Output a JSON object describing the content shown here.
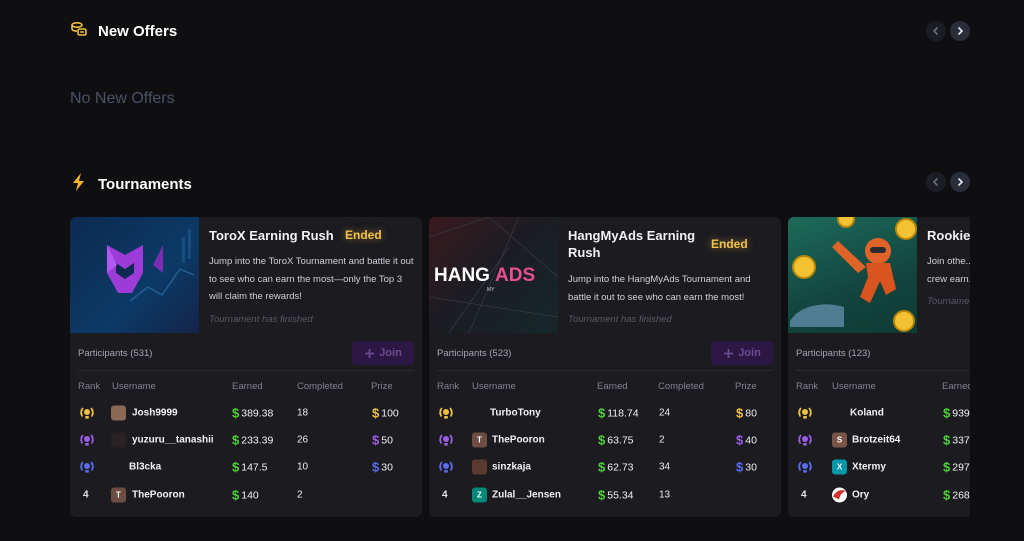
{
  "offers": {
    "title": "New Offers",
    "icon": "coins-icon",
    "empty_text": "No New Offers"
  },
  "tournaments": {
    "title": "Tournaments",
    "icon": "lightning-icon",
    "headers": {
      "rank": "Rank",
      "username": "Username",
      "earned": "Earned",
      "completed": "Completed",
      "prize": "Prize"
    },
    "join_label": "Join",
    "cards": [
      {
        "title": "ToroX Earning Rush",
        "status": "Ended",
        "description": "Jump into the ToroX Tournament and battle it out to see who can earn the most—only the Top 3 will claim the rewards!",
        "finished": "Tournament has finished",
        "participants": "Participants (531)",
        "rows": [
          {
            "rank": "1",
            "username": "Josh9999",
            "earned": "389.38",
            "completed": "18",
            "prize": "100",
            "avatar_letter": "",
            "avatar_color": "#8a6a55"
          },
          {
            "rank": "2",
            "username": "yuzuru__tanashii",
            "earned": "233.39",
            "completed": "26",
            "prize": "50",
            "avatar_letter": "",
            "avatar_color": "#2b2024"
          },
          {
            "rank": "3",
            "username": "Bl3cka",
            "earned": "147.5",
            "completed": "10",
            "prize": "30",
            "avatar_letter": "",
            "avatar_color": ""
          },
          {
            "rank": "4",
            "username": "ThePooron",
            "earned": "140",
            "completed": "2",
            "prize": "",
            "avatar_letter": "T",
            "avatar_color": "#6d4c41"
          }
        ]
      },
      {
        "title": "HangMyAds Earning Rush",
        "status": "Ended",
        "description": "Jump into the HangMyAds Tournament and battle it out to see who can earn the most!",
        "finished": "Tournament has finished",
        "participants": "Participants (523)",
        "thumb_text": {
          "a": "HANG",
          "my": "MY",
          "b": "ADS"
        },
        "rows": [
          {
            "rank": "1",
            "username": "TurboTony",
            "earned": "118.74",
            "completed": "24",
            "prize": "80",
            "avatar_letter": "",
            "avatar_color": ""
          },
          {
            "rank": "2",
            "username": "ThePooron",
            "earned": "63.75",
            "completed": "2",
            "prize": "40",
            "avatar_letter": "T",
            "avatar_color": "#6d4c41"
          },
          {
            "rank": "3",
            "username": "sinzkaja",
            "earned": "62.73",
            "completed": "34",
            "prize": "30",
            "avatar_letter": "",
            "avatar_color": "#5a3a2e"
          },
          {
            "rank": "4",
            "username": "Zulal__Jensen",
            "earned": "55.34",
            "completed": "13",
            "prize": "",
            "avatar_letter": "Z",
            "avatar_color": "#00897b"
          }
        ]
      },
      {
        "title": "Rookie ...",
        "status": "",
        "description": "Join othe... crew earn...",
        "finished": "Tourname...",
        "participants": "Participants (123)",
        "rows": [
          {
            "rank": "1",
            "username": "Koland",
            "earned": "939",
            "completed": "",
            "prize": "",
            "avatar_letter": "",
            "avatar_color": ""
          },
          {
            "rank": "2",
            "username": "Brotzeit64",
            "earned": "337",
            "completed": "",
            "prize": "",
            "avatar_letter": "S",
            "avatar_color": "#795548"
          },
          {
            "rank": "3",
            "username": "Xtermy",
            "earned": "297",
            "completed": "",
            "prize": "",
            "avatar_letter": "X",
            "avatar_color": "#0097a7"
          },
          {
            "rank": "4",
            "username": "Ory",
            "earned": "268",
            "completed": "",
            "prize": "",
            "avatar_letter": "",
            "avatar_color": "#d32f2f"
          }
        ]
      }
    ]
  },
  "colors": {
    "background": "#0f0f12",
    "card": "#1b1b20",
    "ended": "#f3c14a",
    "green": "#4cd137",
    "gold": "#f2c040",
    "silver_purple": "#9b5de5",
    "bronze_blue": "#5b6cf0"
  }
}
